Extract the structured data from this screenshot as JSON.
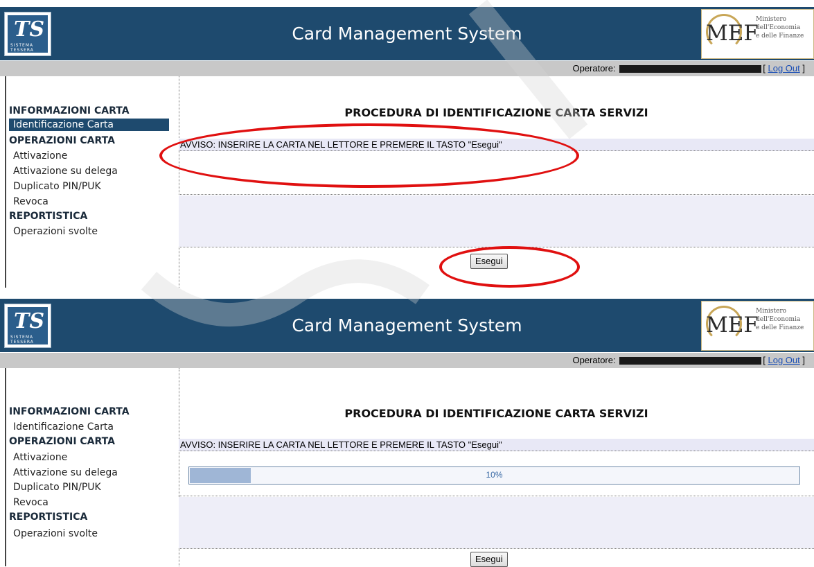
{
  "app_title": "Card Management System",
  "logos": {
    "ts_text": "TS",
    "ts_sub": "SISTEMA TESSERA",
    "mef_text": "MEF",
    "mef_line1": "Ministero",
    "mef_line2": "dell'Economia",
    "mef_line3": "e delle Finanze"
  },
  "operator": {
    "label": "Operatore:",
    "logout_open": "[",
    "logout": "Log Out",
    "logout_close": "]"
  },
  "sidebar": {
    "section_info": "INFORMAZIONI CARTA",
    "item_identificazione": "Identificazione Carta",
    "section_ops": "OPERAZIONI CARTA",
    "item_attivazione": "Attivazione",
    "item_attivazione_delega": "Attivazione su delega",
    "item_duplicato": "Duplicato PIN/PUK",
    "item_revoca": "Revoca",
    "section_report": "REPORTISTICA",
    "item_operazioni": "Operazioni svolte"
  },
  "main": {
    "title": "PROCEDURA DI IDENTIFICAZIONE CARTA SERVIZI",
    "avviso": "AVVISO: INSERIRE LA CARTA NEL LETTORE E PREMERE IL TASTO \"Esegui\"",
    "button": "Esegui"
  },
  "progress": {
    "label": "10%",
    "fraction": 0.1
  },
  "colors": {
    "header": "#1e4a6e",
    "highlight": "#e01010",
    "opbar": "#c8c8c8",
    "avviso_bg": "#e8e8f6"
  }
}
